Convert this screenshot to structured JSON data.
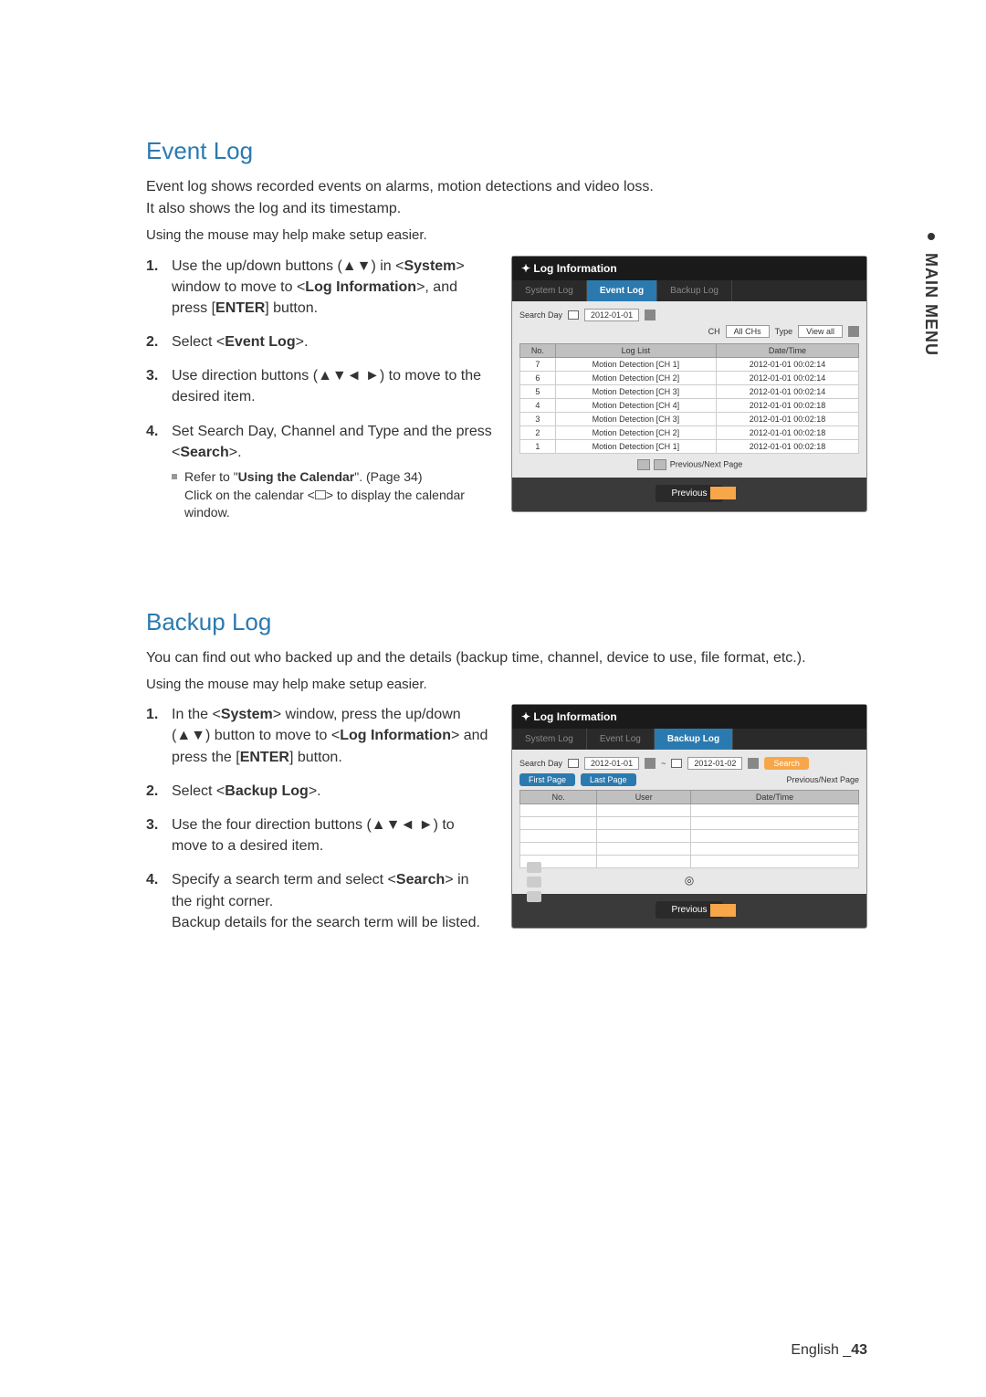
{
  "side_tab_label": "MAIN MENU",
  "event_log": {
    "title": "Event Log",
    "intro": "Event log shows recorded events on alarms, motion detections and video loss.\nIt also shows the log and its timestamp.",
    "hint": "Using the mouse may help make setup easier.",
    "steps": {
      "s1": {
        "n": "1.",
        "pre": "Use the up/down buttons (▲▼) in <",
        "b1": "System",
        "mid1": "> window to move to <",
        "b2": "Log Information",
        "mid2": ">, and press [",
        "b3": "ENTER",
        "post": "] button."
      },
      "s2": {
        "n": "2.",
        "pre": "Select <",
        "b1": "Event Log",
        "post": ">."
      },
      "s3": {
        "n": "3.",
        "txt": "Use direction buttons (▲▼◄ ►) to move to the desired item."
      },
      "s4": {
        "n": "4.",
        "pre": "Set Search Day, Channel and Type and the press <",
        "b1": "Search",
        "post": ">."
      },
      "sub_ref_pre": "Refer to \"",
      "sub_ref_bold": "Using the Calendar",
      "sub_ref_post": "\". (Page 34)",
      "sub_ref_line2_pre": "Click on the calendar <",
      "sub_ref_line2_post": "> to display the calendar window."
    },
    "shot": {
      "win_title": "Log Information",
      "tabs": [
        "System Log",
        "Event Log",
        "Backup Log"
      ],
      "active_tab": 1,
      "search_day_label": "Search Day",
      "date": "2012-01-01",
      "ch_label": "CH",
      "ch_value": "All CHs",
      "type_label": "Type",
      "type_value": "View all",
      "cols": [
        "No.",
        "Log List",
        "Date/Time"
      ],
      "rows": [
        {
          "no": "7",
          "list": "Motion Detection [CH 1]",
          "dt": "2012-01-01 00:02:14"
        },
        {
          "no": "6",
          "list": "Motion Detection [CH 2]",
          "dt": "2012-01-01 00:02:14"
        },
        {
          "no": "5",
          "list": "Motion Detection [CH 3]",
          "dt": "2012-01-01 00:02:14"
        },
        {
          "no": "4",
          "list": "Motion Detection [CH 4]",
          "dt": "2012-01-01 00:02:18"
        },
        {
          "no": "3",
          "list": "Motion Detection [CH 3]",
          "dt": "2012-01-01 00:02:18"
        },
        {
          "no": "2",
          "list": "Motion Detection [CH 2]",
          "dt": "2012-01-01 00:02:18"
        },
        {
          "no": "1",
          "list": "Motion Detection [CH 1]",
          "dt": "2012-01-01 00:02:18"
        }
      ],
      "pager_label": "Previous/Next Page",
      "prev_btn": "Previous"
    }
  },
  "backup_log": {
    "title": "Backup Log",
    "intro": "You can find out who backed up and the details (backup time, channel, device to use, file format, etc.).",
    "hint": "Using the mouse may help make setup easier.",
    "steps": {
      "s1": {
        "n": "1.",
        "pre": "In the <",
        "b1": "System",
        "mid1": "> window, press the up/down (▲▼) button to move to <",
        "b2": "Log Information",
        "mid2": "> and press the [",
        "b3": "ENTER",
        "post": "] button."
      },
      "s2": {
        "n": "2.",
        "pre": "Select <",
        "b1": "Backup Log",
        "post": ">."
      },
      "s3": {
        "n": "3.",
        "txt": "Use the four direction buttons (▲▼◄ ►) to move to a desired item."
      },
      "s4": {
        "n": "4.",
        "pre": "Specify a search term and select <",
        "b1": "Search",
        "mid": "> in the right corner.",
        "line2": "Backup details for the search term will be listed."
      }
    },
    "shot": {
      "win_title": "Log Information",
      "tabs": [
        "System Log",
        "Event Log",
        "Backup Log"
      ],
      "active_tab": 2,
      "search_day_label": "Search Day",
      "date1": "2012-01-01",
      "date2": "2012-01-02",
      "search_btn": "Search",
      "first_page": "First Page",
      "last_page": "Last Page",
      "pager_label": "Previous/Next Page",
      "cols": [
        "No.",
        "User",
        "Date/Time"
      ],
      "prev_btn": "Previous"
    }
  },
  "footer": {
    "lang": "English",
    "sep": "_",
    "pg": "43"
  }
}
